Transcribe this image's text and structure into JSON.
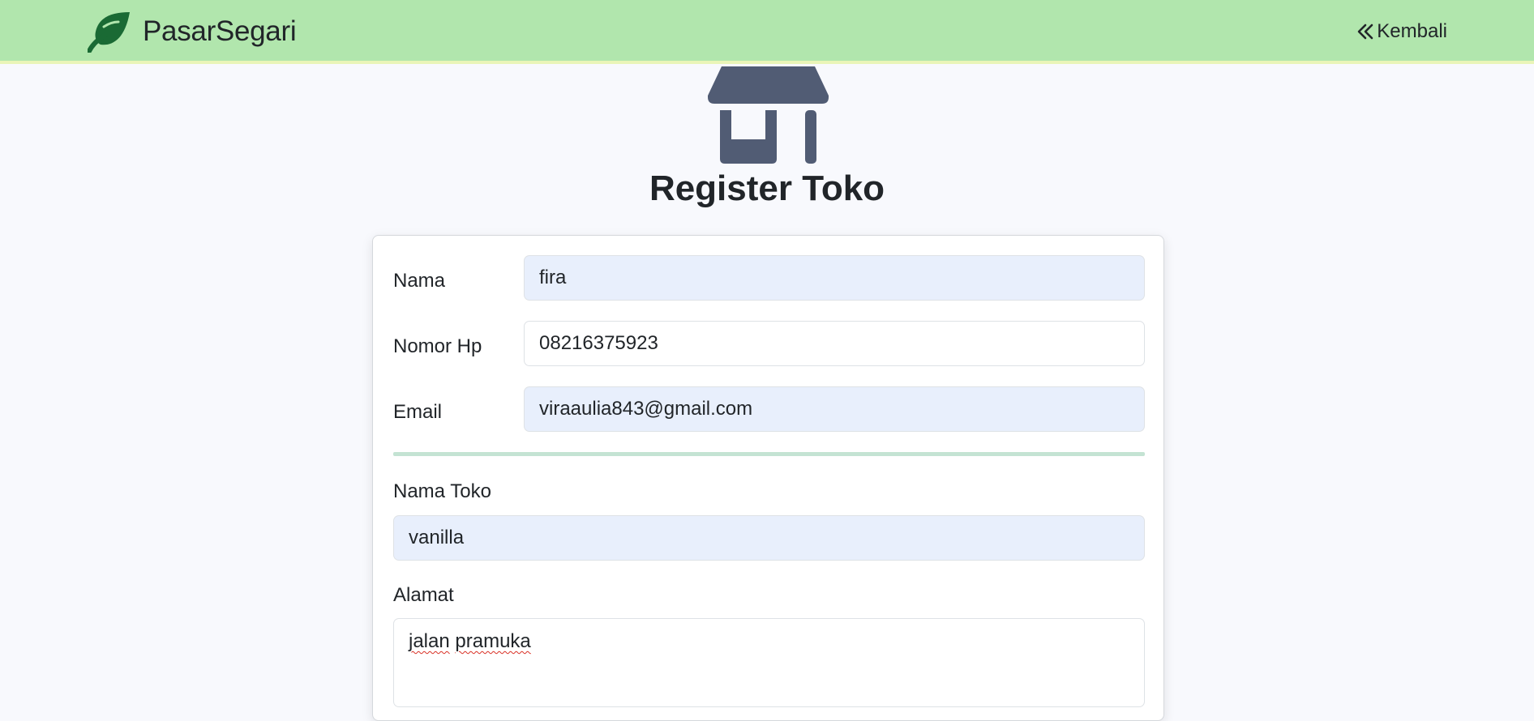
{
  "navbar": {
    "brand": "PasarSegari",
    "back_label": "Kembali",
    "bg_color": "#b1e6ad"
  },
  "icons": {
    "brand_icon": "leaf-icon",
    "back_icon": "double-chevron-left-icon",
    "hero_icon": "shop-icon"
  },
  "page": {
    "title": "Register Toko"
  },
  "form": {
    "nama": {
      "label": "Nama",
      "value": "fira"
    },
    "nomor_hp": {
      "label": "Nomor Hp",
      "value": "08216375923"
    },
    "email": {
      "label": "Email",
      "value": "viraaulia843@gmail.com"
    },
    "nama_toko": {
      "label": "Nama Toko",
      "value": "vanilla"
    },
    "alamat": {
      "label": "Alamat",
      "value_word1": "jalan",
      "value_word2": "pramuka"
    }
  }
}
